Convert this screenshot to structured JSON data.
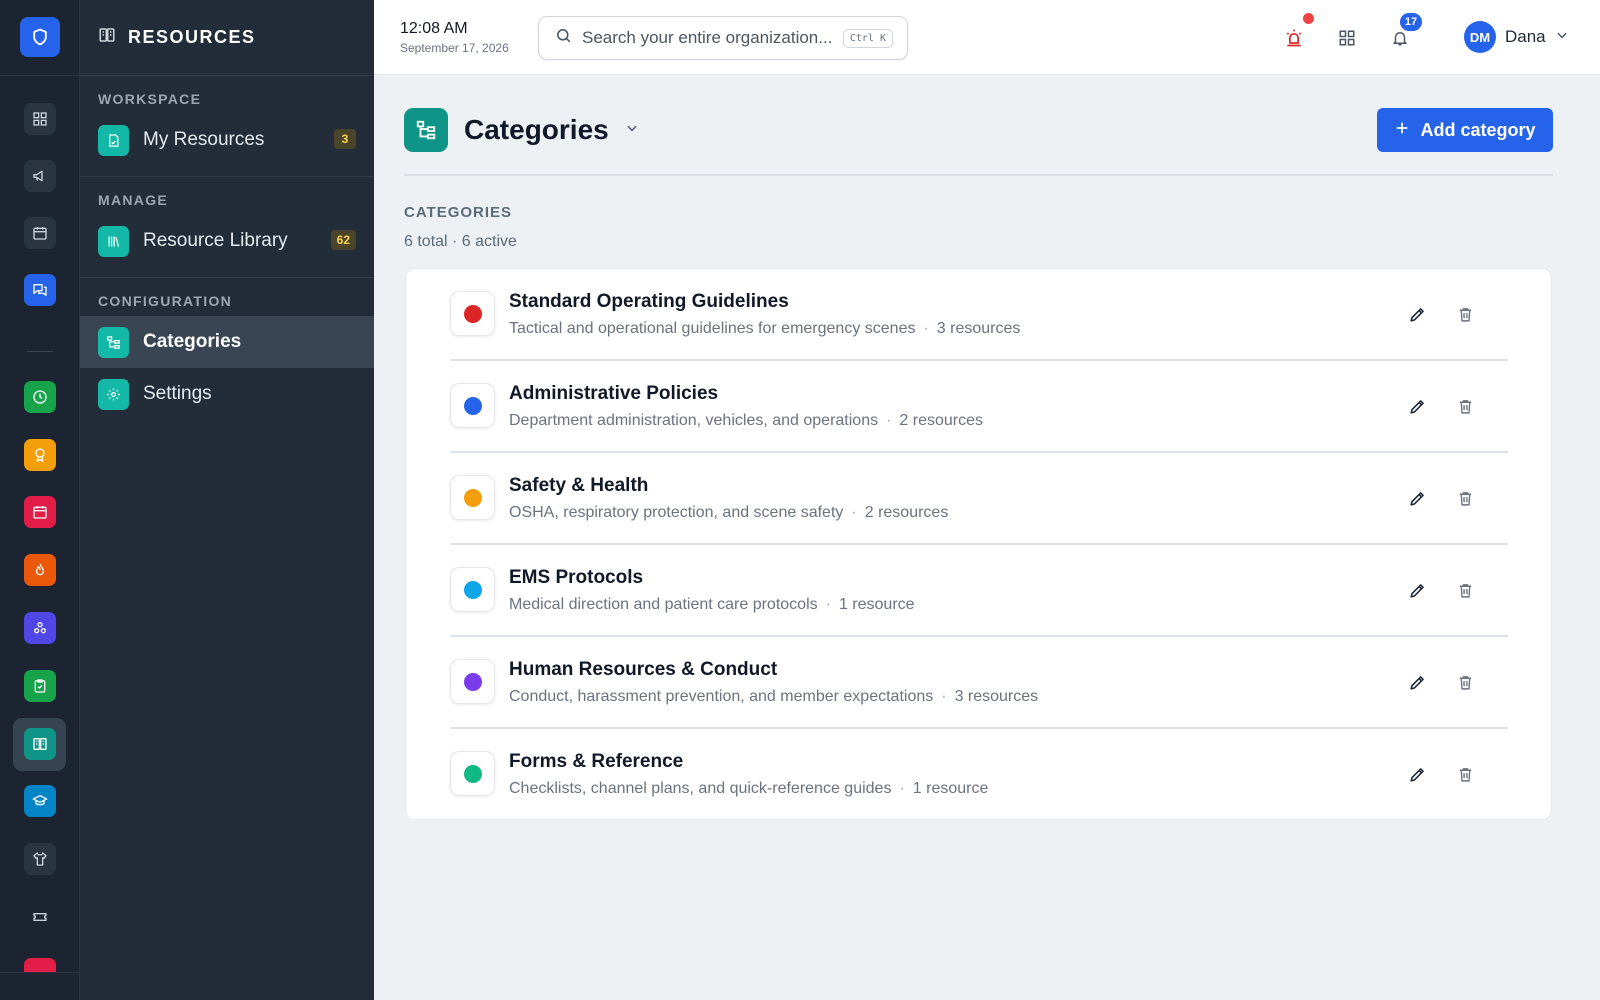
{
  "rail": {
    "items": [
      {
        "icon": "dashboard-icon",
        "color": "#2b3542"
      },
      {
        "icon": "megaphone-icon",
        "color": "#2b3542"
      },
      {
        "icon": "calendar-icon",
        "color": "#2b3542"
      },
      {
        "icon": "chat-icon",
        "color": "#2563eb"
      },
      {
        "icon": "clock-icon",
        "color": "#16a34a"
      },
      {
        "icon": "award-icon",
        "color": "#f59e0b"
      },
      {
        "icon": "calendar-event-icon",
        "color": "#e11d48"
      },
      {
        "icon": "flame-icon",
        "color": "#ea580c"
      },
      {
        "icon": "network-icon",
        "color": "#4f46e5"
      },
      {
        "icon": "clipboard-check-icon",
        "color": "#16a34a"
      },
      {
        "icon": "resources-icon",
        "color": "#0f9488"
      },
      {
        "icon": "graduation-cap-icon",
        "color": "#0284c7"
      },
      {
        "icon": "shirt-icon",
        "color": "#2b3542"
      },
      {
        "icon": "ticket-icon",
        "color": "#1b2430"
      }
    ]
  },
  "sidebar": {
    "title": "RESOURCES",
    "sections": [
      {
        "label": "WORKSPACE",
        "items": [
          {
            "label": "My Resources",
            "badge": "3",
            "icon": "file-icon"
          }
        ]
      },
      {
        "label": "MANAGE",
        "items": [
          {
            "label": "Resource Library",
            "badge": "62",
            "icon": "library-icon"
          }
        ]
      },
      {
        "label": "CONFIGURATION",
        "items": [
          {
            "label": "Categories",
            "icon": "category-tree-icon",
            "active": true
          },
          {
            "label": "Settings",
            "icon": "settings-icon"
          }
        ]
      }
    ]
  },
  "topbar": {
    "time": "12:08 AM",
    "date": "September 17, 2026",
    "search_placeholder": "Search your entire organization...",
    "shortcut": "Ctrl K",
    "notification_count": "17",
    "user_initials": "DM",
    "user_name": "Dana"
  },
  "page": {
    "title": "Categories",
    "add_label": "Add category",
    "section_label": "CATEGORIES",
    "section_summary": "6 total · 6 active"
  },
  "categories": [
    {
      "name": "Standard Operating Guidelines",
      "description": "Tactical and operational guidelines for emergency scenes",
      "count": "3 resources",
      "color": "#dc2626"
    },
    {
      "name": "Administrative Policies",
      "description": "Department administration, vehicles, and operations",
      "count": "2 resources",
      "color": "#2563eb"
    },
    {
      "name": "Safety & Health",
      "description": "OSHA, respiratory protection, and scene safety",
      "count": "2 resources",
      "color": "#f59e0b"
    },
    {
      "name": "EMS Protocols",
      "description": "Medical direction and patient care protocols",
      "count": "1 resource",
      "color": "#0ea5e9"
    },
    {
      "name": "Human Resources & Conduct",
      "description": "Conduct, harassment prevention, and member expectations",
      "count": "3 resources",
      "color": "#7c3aed"
    },
    {
      "name": "Forms & Reference",
      "description": "Checklists, channel plans, and quick-reference guides",
      "count": "1 resource",
      "color": "#10b981"
    }
  ]
}
